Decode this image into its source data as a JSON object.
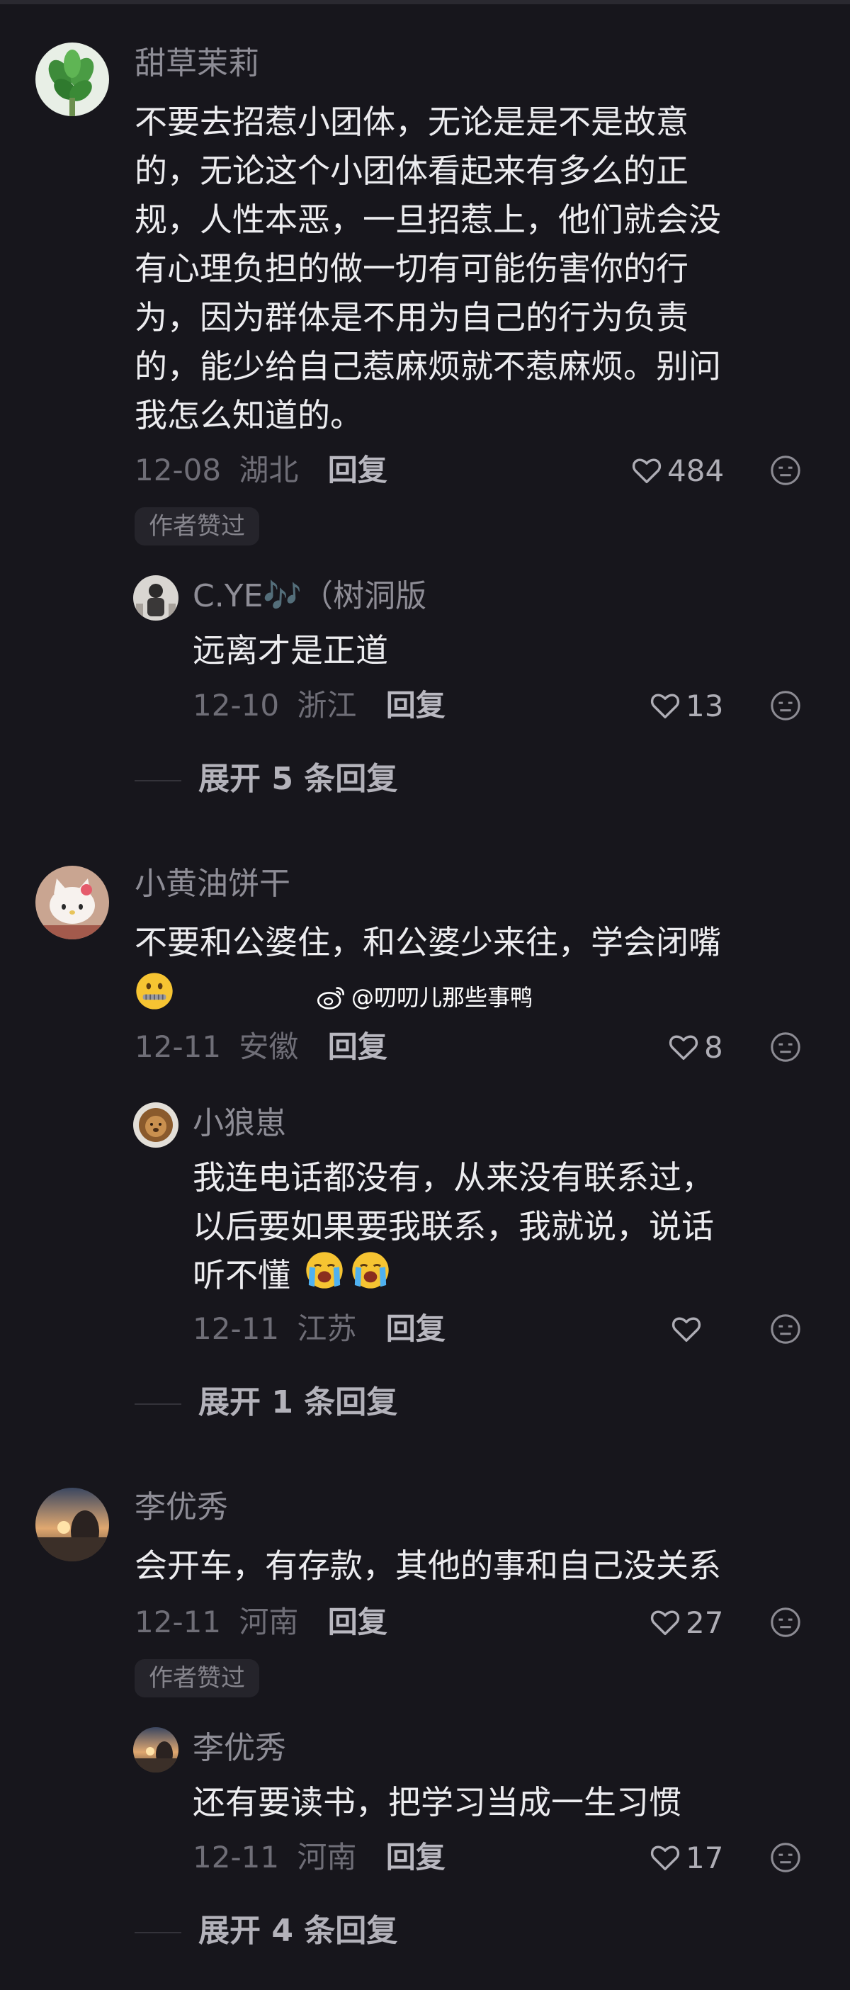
{
  "comments": [
    {
      "username": "甜草茉莉",
      "text": "不要去招惹小团体，无论是是不是故意\n的，无论这个小团体看起来有多么的正\n规，人性本恶，一旦招惹上，他们就会没\n有心理负担的做一切有可能伤害你的行\n为，因为群体是不用为自己的行为负责\n的，能少给自己惹麻烦就不惹麻烦。别问\n我怎么知道的。",
      "date": "12-08",
      "location": "湖北",
      "reply_label": "回复",
      "likes": "484",
      "badge": "作者赞过",
      "avatar_icon": "plant-avatar",
      "reply": {
        "username": "C.YE🎶（树洞版",
        "text": "远离才是正道",
        "date": "12-10",
        "location": "浙江",
        "reply_label": "回复",
        "likes": "13",
        "avatar_icon": "person-avatar"
      },
      "expand": "展开 5 条回复"
    },
    {
      "username": "小黄油饼干",
      "text": "不要和公婆住，和公婆少来往，学会闭嘴",
      "emoji": "zipper-mouth-face",
      "date": "12-11",
      "location": "安徽",
      "reply_label": "回复",
      "likes": "8",
      "avatar_icon": "hello-kitty-avatar",
      "reply": {
        "username": "小狼崽",
        "text": "我连电话都没有，从来没有联系过，\n以后要如果要我联系，我就说，说话\n听不懂",
        "emoji": "loudly-crying-face",
        "date": "12-11",
        "location": "江苏",
        "reply_label": "回复",
        "likes": "",
        "avatar_icon": "lion-avatar"
      },
      "expand": "展开 1 条回复"
    },
    {
      "username": "李优秀",
      "text": "会开车，有存款，其他的事和自己没关系",
      "date": "12-11",
      "location": "河南",
      "reply_label": "回复",
      "likes": "27",
      "badge": "作者赞过",
      "avatar_icon": "sunset-avatar",
      "reply": {
        "username": "李优秀",
        "text": "还有要读书，把学习当成一生习惯",
        "date": "12-11",
        "location": "河南",
        "reply_label": "回复",
        "likes": "17",
        "avatar_icon": "sunset-avatar"
      },
      "expand": "展开 4 条回复"
    }
  ],
  "watermark": "@叨叨儿那些事鸭",
  "colors": {
    "background": "#17161c",
    "text": "#ececef",
    "muted": "#6f6e77"
  }
}
